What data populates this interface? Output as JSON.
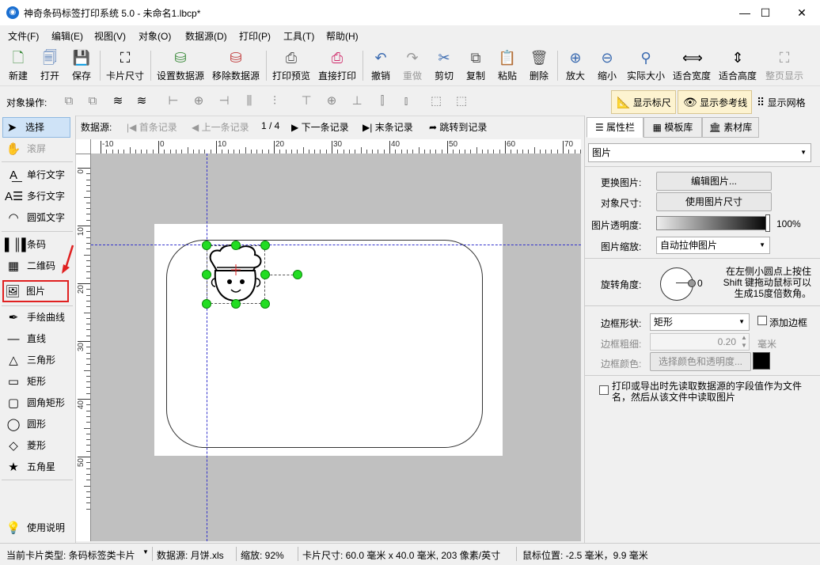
{
  "window": {
    "title": "神奇条码标签打印系统 5.0 - 未命名1.lbcp*",
    "controls": {
      "minimize": "—",
      "maximize": "☐",
      "close": "✕"
    }
  },
  "menu": [
    "文件(F)",
    "编辑(E)",
    "视图(V)",
    "对象(O)",
    "数据源(D)",
    "打印(P)",
    "工具(T)",
    "帮助(H)"
  ],
  "toolbar": {
    "new": "新建",
    "open": "打开",
    "save": "保存",
    "card_size": "卡片尺寸",
    "set_datasource": "设置数据源",
    "remove_datasource": "移除数据源",
    "print_preview": "打印预览",
    "direct_print": "直接打印",
    "undo": "撤销",
    "redo": "重做",
    "cut": "剪切",
    "copy": "复制",
    "paste": "粘贴",
    "delete": "删除",
    "zoom_in": "放大",
    "zoom_out": "缩小",
    "actual_size": "实际大小",
    "fit_width": "适合宽度",
    "fit_height": "适合高度",
    "full_page": "整页显示"
  },
  "ops": {
    "label": "对象操作:",
    "show_ruler": "显示标尺",
    "show_guides": "显示参考线",
    "show_grid": "显示网格"
  },
  "tools": {
    "select": "选择",
    "scroll": "滚屏",
    "single_text": "单行文字",
    "multi_text": "多行文字",
    "arc_text": "圆弧文字",
    "barcode": "条码",
    "qrcode": "二维码",
    "image": "图片",
    "freehand": "手绘曲线",
    "line": "直线",
    "triangle": "三角形",
    "rect": "矩形",
    "round_rect": "圆角矩形",
    "circle": "圆形",
    "diamond": "菱形",
    "star": "五角星",
    "help": "使用说明"
  },
  "nav": {
    "datasource_label": "数据源:",
    "first": "首条记录",
    "prev": "上一条记录",
    "position": "1 / 4",
    "next": "下一条记录",
    "last": "末条记录",
    "jump": "跳转到记录"
  },
  "ruler": {
    "h_ticks": [
      "-10",
      "0",
      "10",
      "20",
      "30",
      "40",
      "50",
      "60",
      "70"
    ],
    "v_ticks": [
      "0",
      "10",
      "20",
      "30",
      "40",
      "50"
    ]
  },
  "panel": {
    "tabs": [
      "属性栏",
      "模板库",
      "素材库"
    ],
    "object_type": "图片",
    "change_image_label": "更换图片:",
    "edit_image_button": "编辑图片...",
    "object_size_label": "对象尺寸:",
    "use_image_size_button": "使用图片尺寸",
    "opacity_label": "图片透明度:",
    "opacity_value": "100%",
    "opacity_level": 1.0,
    "scale_label": "图片缩放:",
    "scale_value": "自动拉伸图片",
    "rotation_label": "旋转角度:",
    "rotation_value": "0",
    "rotation_hint": "在左侧小圆点上按住 Shift 键拖动鼠标可以生成15度倍数角。",
    "border_shape_label": "边框形状:",
    "border_shape_value": "矩形",
    "add_border_label": "添加边框",
    "border_width_label": "边框粗细:",
    "border_width_value": "0.20",
    "border_width_unit": "毫米",
    "border_color_label": "边框颜色:",
    "border_color_button": "选择颜色和透明度...",
    "border_color": "#000000",
    "read_from_file_label": "打印或导出时先读取数据源的字段值作为文件名，然后从该文件中读取图片"
  },
  "status": {
    "card_type": "当前卡片类型: 条码标签类卡片",
    "datasource": "数据源: 月饼.xls",
    "zoom": "缩放: 92%",
    "card_size": "卡片尺寸: 60.0 毫米 x 40.0 毫米, 203 像素/英寸",
    "mouse_pos": "鼠标位置: -2.5 毫米，9.9 毫米"
  },
  "colors": {
    "accent_highlight": "#fdf3d0",
    "handle": "#22dd22",
    "guide": "#3333cc",
    "annotation_red": "#e02020"
  }
}
